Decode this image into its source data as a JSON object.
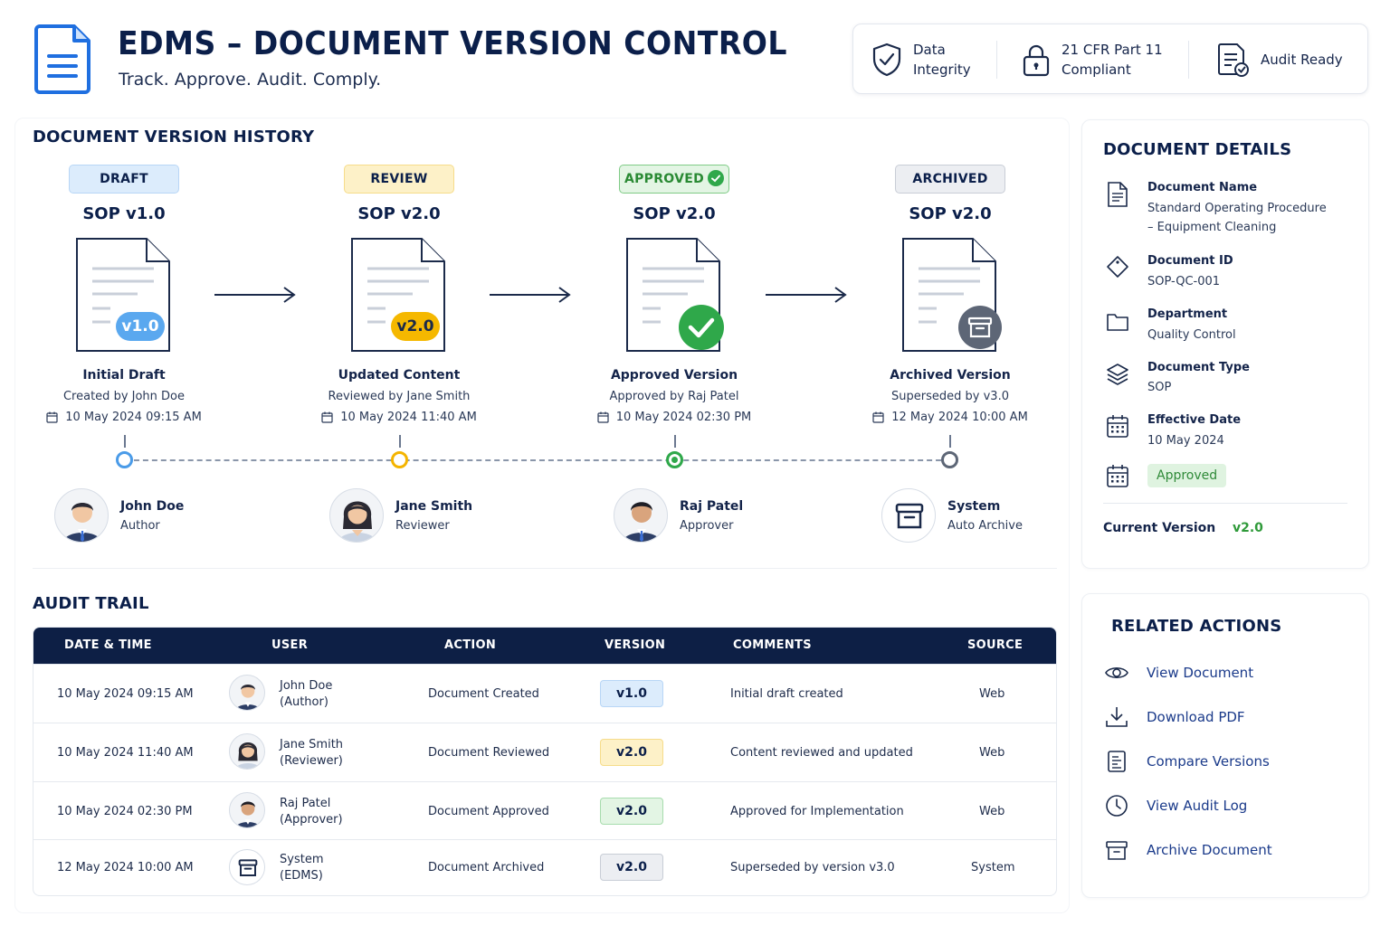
{
  "header": {
    "title": "EDMS – DOCUMENT VERSION CONTROL",
    "subtitle": "Track. Approve. Audit. Comply.",
    "badges": [
      {
        "line1": "Data",
        "line2": "Integrity",
        "icon": "shield-check-icon"
      },
      {
        "line1": "21 CFR Part 11",
        "line2": "Compliant",
        "icon": "lock-icon"
      },
      {
        "line1": "Audit Ready",
        "line2": "",
        "icon": "checklist-icon"
      }
    ]
  },
  "history": {
    "title": "DOCUMENT VERSION HISTORY",
    "stages": [
      {
        "status": "DRAFT",
        "version": "SOP v1.0",
        "badge": "v1.0",
        "title": "Initial Draft",
        "by": "Created by John Doe",
        "date": "10 May 2024 09:15 AM",
        "person": "John Doe",
        "role": "Author"
      },
      {
        "status": "REVIEW",
        "version": "SOP v2.0",
        "badge": "v2.0",
        "title": "Updated Content",
        "by": "Reviewed by Jane Smith",
        "date": "10 May 2024 11:40 AM",
        "person": "Jane Smith",
        "role": "Reviewer"
      },
      {
        "status": "APPROVED",
        "version": "SOP v2.0",
        "badge": "",
        "title": "Approved Version",
        "by": "Approved by Raj Patel",
        "date": "10 May 2024 02:30 PM",
        "person": "Raj Patel",
        "role": "Approver"
      },
      {
        "status": "ARCHIVED",
        "version": "SOP v2.0",
        "badge": "",
        "title": "Archived Version",
        "by": "Superseded by v3.0",
        "date": "12 May 2024 10:00 AM",
        "person": "System",
        "role": "Auto Archive"
      }
    ]
  },
  "audit": {
    "title": "AUDIT TRAIL",
    "columns": [
      "DATE & TIME",
      "USER",
      "ACTION",
      "VERSION",
      "COMMENTS",
      "SOURCE"
    ],
    "rows": [
      {
        "date": "10 May 2024 09:15 AM",
        "user": "John Doe",
        "role": "(Author)",
        "action": "Document Created",
        "version": "v1.0",
        "comment": "Initial draft created",
        "source": "Web"
      },
      {
        "date": "10 May 2024 11:40 AM",
        "user": "Jane Smith",
        "role": "(Reviewer)",
        "action": "Document Reviewed",
        "version": "v2.0",
        "comment": "Content reviewed and updated",
        "source": "Web"
      },
      {
        "date": "10 May 2024 02:30 PM",
        "user": "Raj Patel",
        "role": "(Approver)",
        "action": "Document Approved",
        "version": "v2.0",
        "comment": "Approved for Implementation",
        "source": "Web"
      },
      {
        "date": "12 May 2024 10:00 AM",
        "user": "System",
        "role": "(EDMS)",
        "action": "Document Archived",
        "version": "v2.0",
        "comment": "Superseded by version v3.0",
        "source": "System"
      }
    ]
  },
  "details": {
    "title": "DOCUMENT DETAILS",
    "name_label": "Document Name",
    "name_line1": "Standard Operating Procedure",
    "name_line2": "– Equipment Cleaning",
    "id_label": "Document ID",
    "id_value": "SOP-QC-001",
    "dept_label": "Department",
    "dept_value": "Quality Control",
    "type_label": "Document Type",
    "type_value": "SOP",
    "date_label": "Effective Date",
    "date_value": "10 May 2024",
    "status_value": "Approved",
    "current_label": "Current Version",
    "current_value": "v2.0"
  },
  "actions": {
    "title": "RELATED ACTIONS",
    "items": [
      "View Document",
      "Download PDF",
      "Compare Versions",
      "View Audit Log",
      "Archive Document"
    ]
  },
  "colors": {
    "navy": "#0b1f4a",
    "blue": "#4a9be8",
    "yellow": "#f4b400",
    "green": "#2fa84a",
    "gray": "#667085"
  }
}
